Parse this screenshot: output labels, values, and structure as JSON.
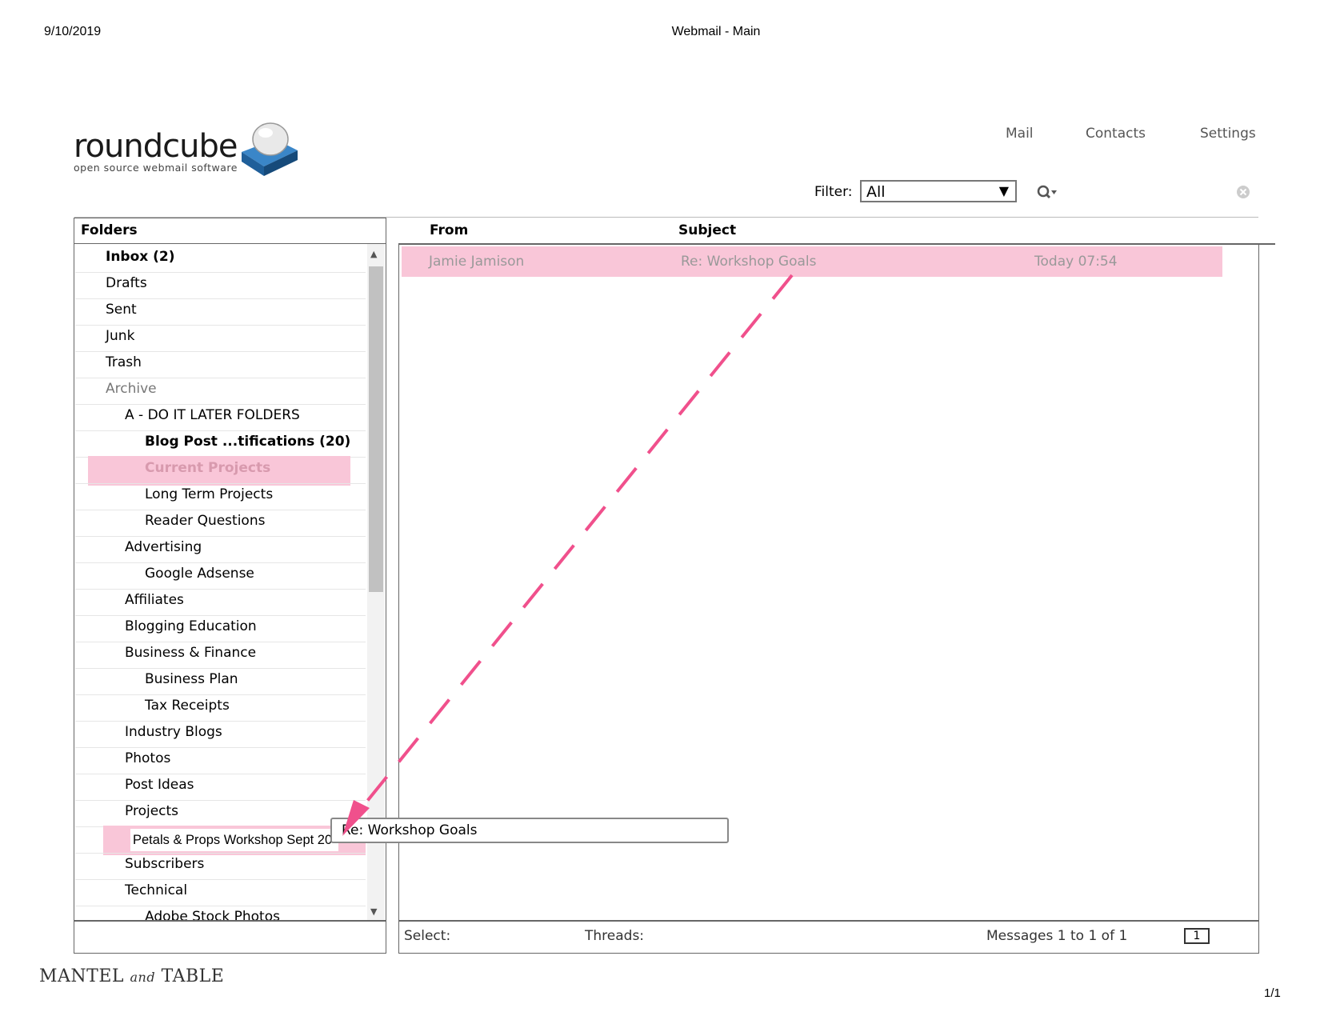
{
  "print_header": {
    "date": "9/10/2019",
    "title": "Webmail - Main",
    "page": "1/1"
  },
  "logo": {
    "name": "roundcube",
    "tagline": "open source webmail software"
  },
  "topnav": {
    "items": [
      "Mail",
      "Contacts",
      "Settings"
    ]
  },
  "filter": {
    "label": "Filter:",
    "value": "All"
  },
  "folders": {
    "header": "Folders",
    "items": [
      {
        "label": "Inbox (2)",
        "level": 0,
        "bold": true
      },
      {
        "label": "Drafts",
        "level": 0
      },
      {
        "label": "Sent",
        "level": 0
      },
      {
        "label": "Junk",
        "level": 0
      },
      {
        "label": "Trash",
        "level": 0
      },
      {
        "label": "Archive",
        "level": 0,
        "muted": true
      },
      {
        "label": "A - DO IT LATER FOLDERS",
        "level": 1
      },
      {
        "label": "Blog Post ...tifications (20)",
        "level": 2,
        "bold": true
      },
      {
        "label": "Current Projects",
        "level": 2,
        "bold": true,
        "highlight": true
      },
      {
        "label": "Long Term Projects",
        "level": 2
      },
      {
        "label": "Reader Questions",
        "level": 2
      },
      {
        "label": "Advertising",
        "level": 1
      },
      {
        "label": "Google Adsense",
        "level": 2
      },
      {
        "label": "Affiliates",
        "level": 1
      },
      {
        "label": "Blogging Education",
        "level": 1
      },
      {
        "label": "Business & Finance",
        "level": 1
      },
      {
        "label": "Business Plan",
        "level": 2
      },
      {
        "label": "Tax Receipts",
        "level": 2
      },
      {
        "label": "Industry Blogs",
        "level": 1
      },
      {
        "label": "Photos",
        "level": 1
      },
      {
        "label": "Post Ideas",
        "level": 1
      },
      {
        "label": "Projects",
        "level": 1
      },
      {
        "label": "Petals & Props Workshop Sept 20",
        "level": 2,
        "drop_target": true
      },
      {
        "label": "Subscribers",
        "level": 1
      },
      {
        "label": "Technical",
        "level": 1
      },
      {
        "label": "Adobe Stock Photos",
        "level": 2
      }
    ]
  },
  "messages": {
    "columns": {
      "from": "From",
      "subject": "Subject"
    },
    "rows": [
      {
        "from": "Jamie Jamison",
        "subject": "Re: Workshop Goals",
        "date": "Today 07:54"
      }
    ]
  },
  "drag_tooltip": "Re: Workshop Goals",
  "footer": {
    "select_label": "Select:",
    "threads_label": "Threads:",
    "count": "Messages 1 to 1 of 1",
    "page_number": "1"
  },
  "brand": {
    "left": "MANTEL",
    "mid": "and",
    "right": "TABLE"
  },
  "colors": {
    "highlight": "#f9c6d8",
    "arrow": "#f0508c"
  }
}
